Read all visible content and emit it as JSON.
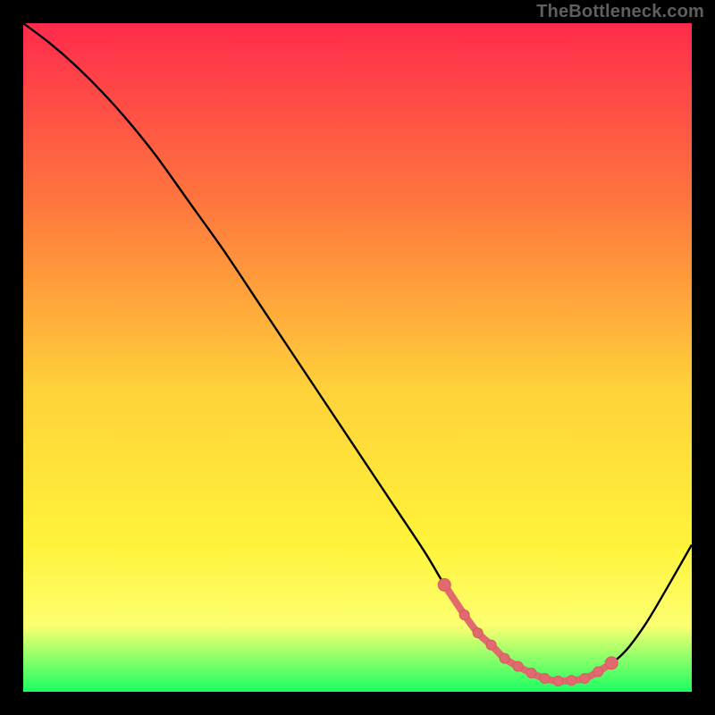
{
  "watermark": "TheBottleneck.com",
  "colors": {
    "bg": "#000000",
    "curve": "#000000",
    "marker_fill": "#e16a6e",
    "marker_stroke": "#d85a5e",
    "grad_top": "#ff2b4c",
    "grad_mid_upper": "#ff7a3d",
    "grad_mid": "#ffd23a",
    "grad_mid_lower": "#fff33a",
    "grad_lower": "#fdff70",
    "grad_bottom": "#19ff62"
  },
  "chart_data": {
    "type": "line",
    "title": "",
    "xlabel": "",
    "ylabel": "",
    "xlim": [
      0,
      100
    ],
    "ylim": [
      0,
      100
    ],
    "series": [
      {
        "name": "bottleneck-curve",
        "x": [
          0,
          4,
          8,
          12,
          16,
          20,
          25,
          30,
          35,
          40,
          45,
          50,
          55,
          60,
          63,
          66,
          69,
          72,
          75,
          78,
          81,
          84,
          87,
          90,
          93,
          96,
          100
        ],
        "y": [
          100,
          97,
          93.5,
          89.5,
          85,
          80,
          73,
          66,
          58.5,
          51,
          43.5,
          36,
          28.5,
          21,
          16,
          11.5,
          8,
          5,
          3,
          2,
          1.5,
          2,
          3.5,
          6,
          10,
          15,
          22
        ]
      }
    ],
    "markers": {
      "name": "optimal-range",
      "x": [
        63,
        66,
        68,
        70,
        72,
        74,
        76,
        78,
        80,
        82,
        84,
        86,
        88
      ],
      "y": [
        16,
        11.5,
        8.8,
        7,
        5,
        3.8,
        2.8,
        2,
        1.6,
        1.7,
        2,
        3,
        4.3
      ]
    }
  }
}
